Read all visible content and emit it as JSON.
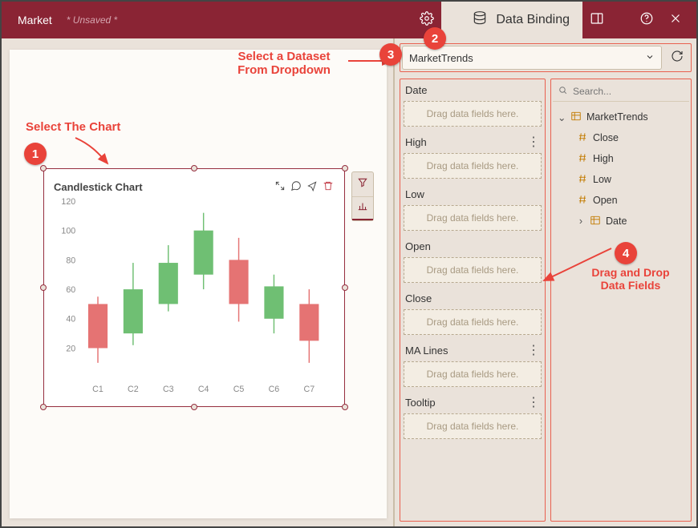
{
  "header": {
    "doc_name": "Market",
    "doc_status": "* Unsaved *",
    "tab_label": "Data Binding"
  },
  "annotations": {
    "select_chart": "Select The Chart",
    "select_dataset_l1": "Select a Dataset",
    "select_dataset_l2": "From Dropdown",
    "drag_l1": "Drag and Drop",
    "drag_l2": "Data Fields",
    "n1": "1",
    "n2": "2",
    "n3": "3",
    "n4": "4"
  },
  "chart": {
    "title": "Candlestick Chart"
  },
  "chart_data": {
    "type": "candlestick",
    "title": "Candlestick Chart",
    "xlabel": "",
    "ylabel": "",
    "ylim": [
      0,
      120
    ],
    "yticks": [
      20,
      40,
      60,
      80,
      100,
      120
    ],
    "categories": [
      "C1",
      "C2",
      "C3",
      "C4",
      "C5",
      "C6",
      "C7"
    ],
    "series": [
      {
        "name": "C1",
        "open": 20,
        "close": 50,
        "high": 55,
        "low": 10,
        "color": "red"
      },
      {
        "name": "C2",
        "open": 30,
        "close": 60,
        "high": 78,
        "low": 22,
        "color": "green"
      },
      {
        "name": "C3",
        "open": 50,
        "close": 78,
        "high": 90,
        "low": 45,
        "color": "green"
      },
      {
        "name": "C4",
        "open": 70,
        "close": 100,
        "high": 112,
        "low": 60,
        "color": "green"
      },
      {
        "name": "C5",
        "open": 80,
        "close": 50,
        "high": 95,
        "low": 38,
        "color": "red"
      },
      {
        "name": "C6",
        "open": 40,
        "close": 62,
        "high": 70,
        "low": 30,
        "color": "green"
      },
      {
        "name": "C7",
        "open": 50,
        "close": 25,
        "high": 60,
        "low": 10,
        "color": "red"
      }
    ]
  },
  "panel": {
    "dataset_selected": "MarketTrends",
    "search_placeholder": "Search...",
    "drop_hint": "Drag data fields here.",
    "slots": [
      {
        "label": "Date",
        "menu": false
      },
      {
        "label": "High",
        "menu": true
      },
      {
        "label": "Low",
        "menu": false
      },
      {
        "label": "Open",
        "menu": false
      },
      {
        "label": "Close",
        "menu": false
      },
      {
        "label": "MA Lines",
        "menu": true
      },
      {
        "label": "Tooltip",
        "menu": true
      }
    ],
    "tree": {
      "root": "MarketTrends",
      "fields": [
        "Close",
        "High",
        "Low",
        "Open"
      ],
      "date_field": "Date"
    }
  }
}
